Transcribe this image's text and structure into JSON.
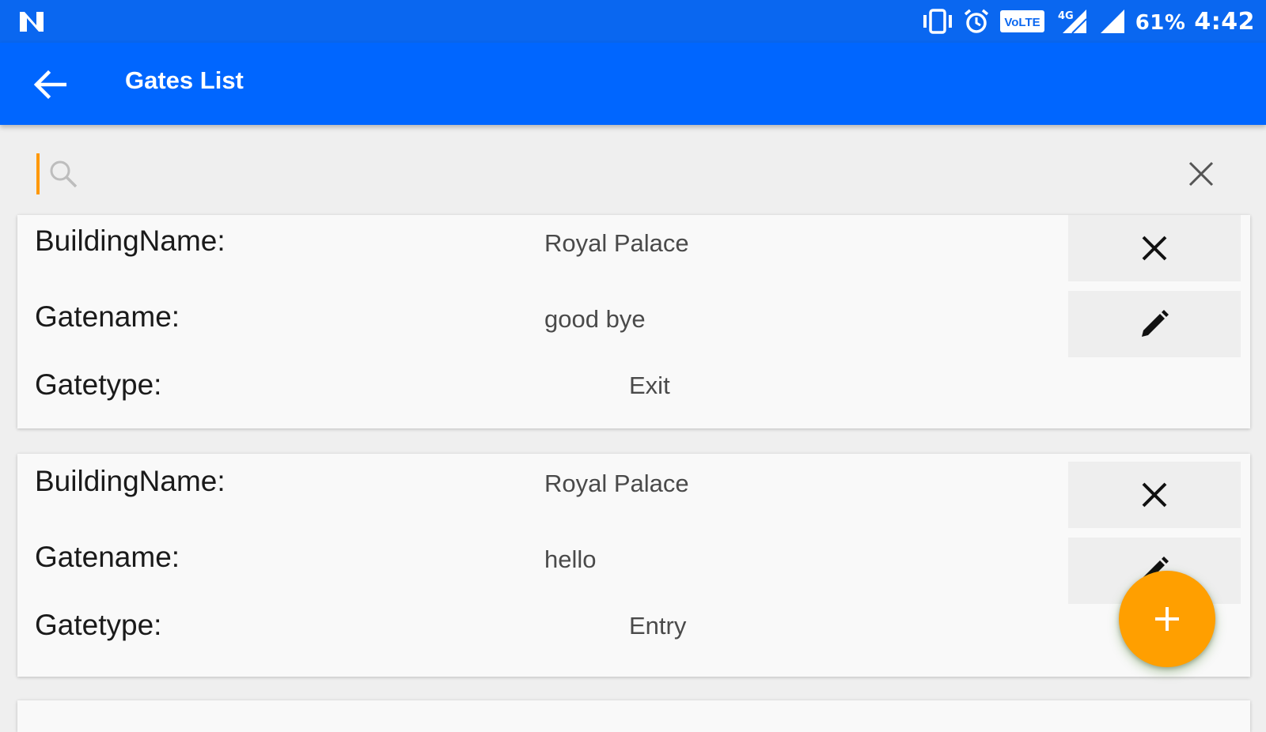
{
  "status_bar": {
    "icons": [
      "n-logo-icon",
      "vibrate-icon",
      "alarm-icon",
      "volte-icon",
      "signal-4g-icon",
      "signal-icon"
    ],
    "volte_label": "VoLTE",
    "network_label": "4G",
    "battery": "61%",
    "time": "4:42"
  },
  "app_bar": {
    "title": "Gates List",
    "back_icon": "arrow-back-icon"
  },
  "search": {
    "placeholder": "",
    "value": "",
    "search_icon": "search-icon",
    "clear_icon": "close-icon"
  },
  "gates": [
    {
      "building_label": "BuildingName:",
      "building_name": "Royal Palace",
      "gatename_label": "Gatename:",
      "gatename": "good bye",
      "gatetype_label": "Gatetype:",
      "gatetype": "Exit"
    },
    {
      "building_label": "BuildingName:",
      "building_name": "Royal Palace",
      "gatename_label": "Gatename:",
      "gatename": "hello",
      "gatetype_label": "Gatetype:",
      "gatetype": "Entry"
    }
  ],
  "fab": {
    "icon": "plus-icon",
    "color": "#ff9f00"
  },
  "colors": {
    "primary": "#0066ff",
    "status_bar": "#0a67f0",
    "accent": "#ff9800"
  }
}
